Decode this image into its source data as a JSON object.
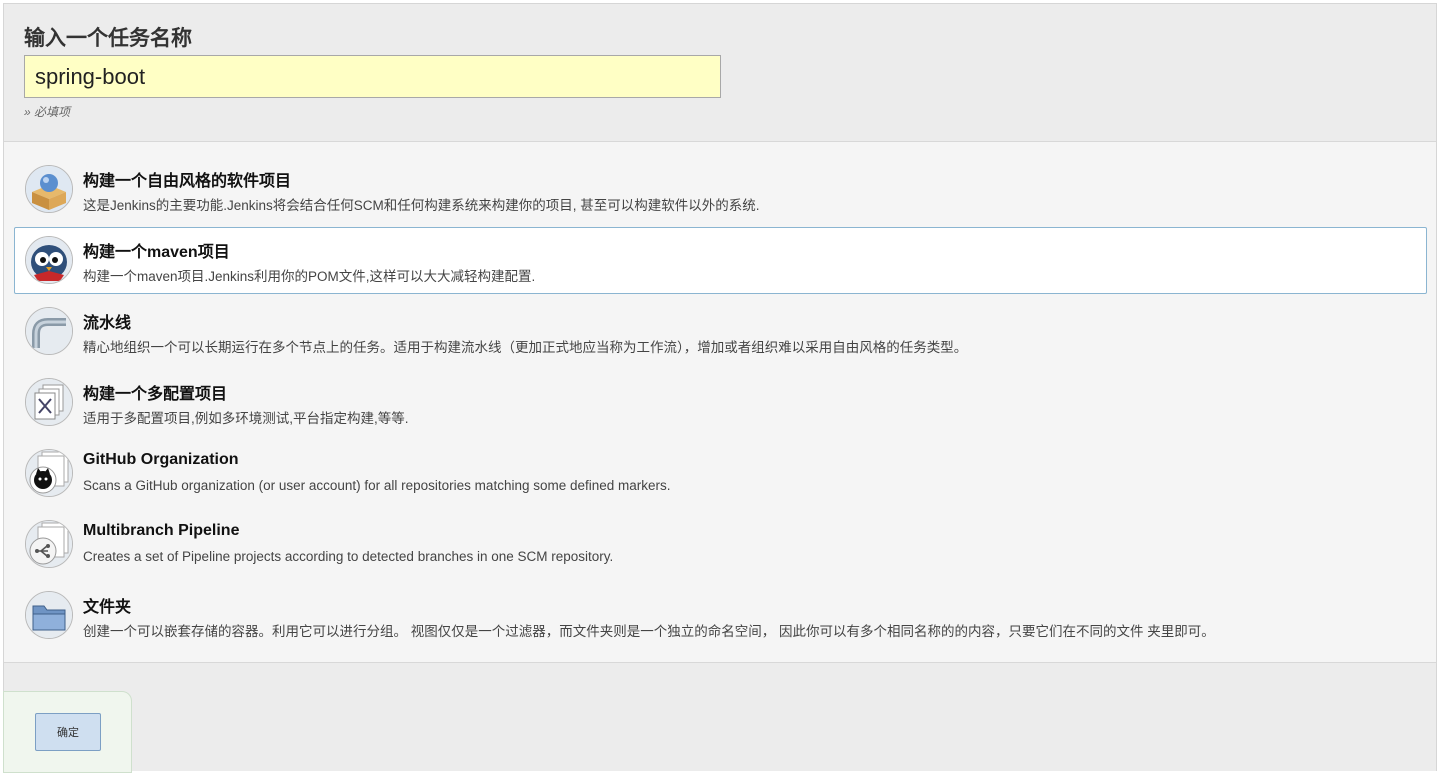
{
  "header": {
    "title": "输入一个任务名称",
    "name_value": "spring-boot",
    "required_note": "» 必填项"
  },
  "items": [
    {
      "icon": "freestyle-project-icon",
      "title": "构建一个自由风格的软件项目",
      "desc": "这是Jenkins的主要功能.Jenkins将会结合任何SCM和任何构建系统来构建你的项目, 甚至可以构建软件以外的系统."
    },
    {
      "icon": "maven-project-icon",
      "title": "构建一个maven项目",
      "desc": "构建一个maven项目.Jenkins利用你的POM文件,这样可以大大减轻构建配置.",
      "selected": true
    },
    {
      "icon": "pipeline-icon",
      "title": "流水线",
      "desc": "精心地组织一个可以长期运行在多个节点上的任务。适用于构建流水线（更加正式地应当称为工作流），增加或者组织难以采用自由风格的任务类型。"
    },
    {
      "icon": "multi-configuration-icon",
      "title": "构建一个多配置项目",
      "desc": "适用于多配置项目,例如多环境测试,平台指定构建,等等."
    },
    {
      "icon": "github-organization-icon",
      "title": "GitHub Organization",
      "desc": "Scans a GitHub organization (or user account) for all repositories matching some defined markers."
    },
    {
      "icon": "multibranch-pipeline-icon",
      "title": "Multibranch Pipeline",
      "desc": "Creates a set of Pipeline projects according to detected branches in one SCM repository."
    },
    {
      "icon": "folder-icon",
      "title": "文件夹",
      "desc": "创建一个可以嵌套存储的容器。利用它可以进行分组。 视图仅仅是一个过滤器，而文件夹则是一个独立的命名空间， 因此你可以有多个相同名称的的内容，只要它们在不同的文件 夹里即可。"
    }
  ],
  "footer": {
    "ok_label": "确定"
  },
  "colors": {
    "input_bg": "#ffffc5",
    "selected_border": "#8bb5d1",
    "ok_button_bg": "#cfdff0"
  }
}
